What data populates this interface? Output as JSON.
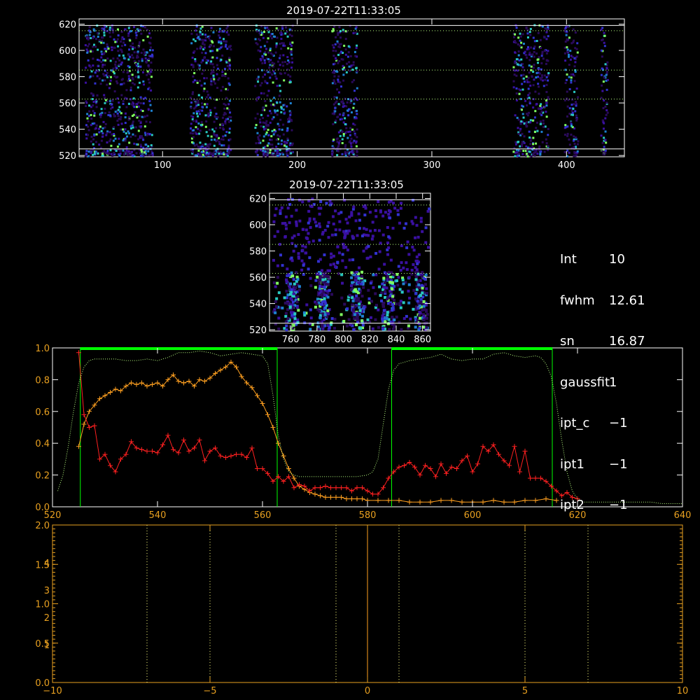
{
  "window_title": "2019-07-22T11:33:05",
  "colors": {
    "frame": "#ffffff",
    "red_axis": "#e8a020",
    "green_window": "#00ff00",
    "dotted_green": "#b8ff80",
    "red_series": "#ff2020",
    "orange_series": "#ffa020",
    "scatter_colormap": [
      "#2a0a5a",
      "#3a10a0",
      "#3232d0",
      "#1e80d0",
      "#28c8c0",
      "#80ff60"
    ]
  },
  "info_panel": [
    {
      "key": "Int",
      "value": "10"
    },
    {
      "key": "fwhm",
      "value": "12.61"
    },
    {
      "key": "sn",
      "value": "16.87"
    },
    {
      "key": "gaussfit",
      "value": "1"
    },
    {
      "key": "ipt_c",
      "value": "−1"
    },
    {
      "key": "ipt1",
      "value": "−1"
    },
    {
      "key": "ipt2",
      "value": "−1"
    }
  ],
  "chart_data": [
    {
      "type": "heatmap",
      "title": "2019-07-22T11:33:05",
      "xlim": [
        38,
        443
      ],
      "ylim": [
        519,
        624
      ],
      "xticks": [
        "100",
        "200",
        "300",
        "400"
      ],
      "xtick_values": [
        100,
        200,
        300,
        400
      ],
      "yticks": [
        "520",
        "540",
        "560",
        "580",
        "600",
        "620"
      ],
      "ytick_values": [
        520,
        540,
        560,
        580,
        600,
        620
      ],
      "hlines_solid": [
        525,
        619
      ],
      "hlines_dotted": [
        563,
        585,
        615
      ],
      "bands": [
        [
          42,
          92
        ],
        [
          120,
          150
        ],
        [
          168,
          196
        ],
        [
          225,
          244
        ],
        [
          360,
          386
        ],
        [
          398,
          408
        ],
        [
          425,
          430
        ]
      ]
    },
    {
      "type": "heatmap",
      "title": "2019-07-22T11:33:05",
      "xlim": [
        744,
        866
      ],
      "ylim": [
        519,
        624
      ],
      "xticks": [
        "760",
        "780",
        "800",
        "820",
        "840",
        "860"
      ],
      "xtick_values": [
        760,
        780,
        800,
        820,
        840,
        860
      ],
      "yticks": [
        "520",
        "540",
        "560",
        "580",
        "600",
        "620"
      ],
      "ytick_values": [
        520,
        540,
        560,
        580,
        600,
        620
      ],
      "hlines_solid": [
        525,
        619
      ],
      "hlines_dotted": [
        563,
        585,
        615
      ],
      "streaks": [
        760,
        784,
        810,
        833,
        858
      ]
    },
    {
      "type": "line",
      "xlim": [
        520,
        640
      ],
      "ylim": [
        0,
        1.0
      ],
      "xticks": [
        "520",
        "540",
        "560",
        "580",
        "600",
        "620",
        "640"
      ],
      "xtick_values": [
        520,
        540,
        560,
        580,
        600,
        620,
        640
      ],
      "yticks": [
        "0.0",
        "0.2",
        "0.4",
        "0.6",
        "0.8",
        "1.0"
      ],
      "ytick_values": [
        0,
        0.2,
        0.4,
        0.6,
        0.8,
        1.0
      ],
      "windows": [
        [
          525.3,
          562.8
        ],
        [
          584.6,
          615.2
        ]
      ],
      "series": [
        {
          "color": "#ffa020",
          "x": [
            525,
            526,
            527,
            528,
            529,
            530,
            531,
            532,
            533,
            534,
            535,
            536,
            537,
            538,
            539,
            540,
            541,
            542,
            543,
            544,
            545,
            546,
            547,
            548,
            549,
            550,
            551,
            552,
            553,
            554,
            555,
            556,
            557,
            558,
            559,
            560,
            561,
            562,
            563,
            564,
            565,
            566,
            567,
            568,
            569,
            570,
            571,
            572,
            573,
            574,
            575,
            576,
            577,
            578,
            579,
            580,
            582,
            584,
            586,
            588,
            590,
            592,
            594,
            596,
            598,
            600,
            602,
            604,
            606,
            608,
            610,
            612,
            614,
            616
          ],
          "y": [
            0.38,
            0.52,
            0.6,
            0.64,
            0.68,
            0.7,
            0.72,
            0.74,
            0.73,
            0.76,
            0.78,
            0.77,
            0.78,
            0.76,
            0.77,
            0.78,
            0.76,
            0.8,
            0.83,
            0.79,
            0.78,
            0.79,
            0.76,
            0.8,
            0.79,
            0.81,
            0.84,
            0.86,
            0.88,
            0.91,
            0.88,
            0.82,
            0.78,
            0.75,
            0.7,
            0.65,
            0.58,
            0.5,
            0.4,
            0.32,
            0.24,
            0.18,
            0.13,
            0.11,
            0.09,
            0.08,
            0.07,
            0.06,
            0.06,
            0.06,
            0.06,
            0.05,
            0.05,
            0.05,
            0.05,
            0.04,
            0.04,
            0.04,
            0.04,
            0.03,
            0.03,
            0.03,
            0.04,
            0.04,
            0.03,
            0.03,
            0.03,
            0.04,
            0.03,
            0.03,
            0.04,
            0.04,
            0.05,
            0.04
          ]
        },
        {
          "color": "#ff2020",
          "x": [
            525,
            526,
            527,
            528,
            529,
            530,
            531,
            532,
            533,
            534,
            535,
            536,
            537,
            538,
            539,
            540,
            541,
            542,
            543,
            544,
            545,
            546,
            547,
            548,
            549,
            550,
            551,
            552,
            553,
            554,
            555,
            556,
            557,
            558,
            559,
            560,
            561,
            562,
            563,
            564,
            565,
            566,
            567,
            568,
            569,
            570,
            571,
            572,
            573,
            574,
            575,
            576,
            577,
            578,
            579,
            580,
            581,
            582,
            583,
            584,
            585,
            586,
            587,
            588,
            589,
            590,
            591,
            592,
            593,
            594,
            595,
            596,
            597,
            598,
            599,
            600,
            601,
            602,
            603,
            604,
            605,
            606,
            607,
            608,
            609,
            610,
            611,
            612,
            613,
            614,
            615,
            616,
            617,
            618,
            619,
            620
          ],
          "y": [
            0.97,
            0.58,
            0.5,
            0.51,
            0.3,
            0.33,
            0.26,
            0.22,
            0.3,
            0.33,
            0.41,
            0.37,
            0.36,
            0.35,
            0.35,
            0.34,
            0.39,
            0.45,
            0.36,
            0.34,
            0.42,
            0.35,
            0.37,
            0.42,
            0.29,
            0.35,
            0.37,
            0.32,
            0.31,
            0.32,
            0.33,
            0.33,
            0.31,
            0.37,
            0.24,
            0.24,
            0.21,
            0.16,
            0.19,
            0.16,
            0.19,
            0.12,
            0.14,
            0.13,
            0.1,
            0.12,
            0.12,
            0.13,
            0.12,
            0.12,
            0.12,
            0.12,
            0.1,
            0.12,
            0.12,
            0.1,
            0.08,
            0.08,
            0.12,
            0.18,
            0.22,
            0.25,
            0.26,
            0.28,
            0.25,
            0.2,
            0.26,
            0.24,
            0.19,
            0.27,
            0.21,
            0.25,
            0.24,
            0.29,
            0.32,
            0.22,
            0.27,
            0.38,
            0.35,
            0.39,
            0.33,
            0.29,
            0.26,
            0.38,
            0.22,
            0.35,
            0.18,
            0.18,
            0.18,
            0.16,
            0.13,
            0.1,
            0.07,
            0.09,
            0.06,
            0.05
          ]
        },
        {
          "color": "#b8ff80",
          "x": [
            521,
            522,
            523,
            524,
            525,
            526,
            527,
            528,
            530,
            532,
            534,
            536,
            538,
            540,
            542,
            544,
            546,
            548,
            550,
            552,
            554,
            556,
            558,
            560,
            561,
            562,
            563,
            564,
            565,
            566,
            567,
            568,
            570,
            572,
            574,
            576,
            578,
            580,
            581,
            582,
            583,
            584,
            585,
            586,
            588,
            590,
            592,
            594,
            596,
            598,
            600,
            602,
            604,
            606,
            608,
            610,
            612,
            613,
            614,
            615,
            616,
            617,
            618,
            619,
            620,
            621,
            622,
            624,
            626,
            628,
            630,
            632,
            634,
            636,
            638,
            640
          ],
          "y": [
            0.1,
            0.2,
            0.38,
            0.6,
            0.78,
            0.88,
            0.92,
            0.93,
            0.93,
            0.93,
            0.92,
            0.92,
            0.93,
            0.92,
            0.94,
            0.97,
            0.97,
            0.98,
            0.97,
            0.95,
            0.96,
            0.97,
            0.96,
            0.95,
            0.9,
            0.7,
            0.45,
            0.3,
            0.22,
            0.2,
            0.19,
            0.19,
            0.19,
            0.19,
            0.19,
            0.19,
            0.19,
            0.2,
            0.22,
            0.3,
            0.52,
            0.74,
            0.86,
            0.9,
            0.92,
            0.93,
            0.94,
            0.96,
            0.93,
            0.92,
            0.93,
            0.93,
            0.96,
            0.97,
            0.95,
            0.94,
            0.95,
            0.94,
            0.9,
            0.82,
            0.65,
            0.42,
            0.22,
            0.1,
            0.05,
            0.03,
            0.03,
            0.03,
            0.03,
            0.03,
            0.03,
            0.03,
            0.03,
            0.02,
            0.02,
            0.02
          ]
        }
      ]
    },
    {
      "type": "line",
      "xlim": [
        -10,
        10
      ],
      "ylim": [
        0,
        2.0
      ],
      "xticks": [
        "−10",
        "−5",
        "0",
        "5",
        "10"
      ],
      "xtick_values": [
        -10,
        -5,
        0,
        5,
        10
      ],
      "yticks": [
        "0.0",
        "0.5",
        "1.0",
        "1.5",
        "2.0"
      ],
      "ytick_values": [
        0,
        0.5,
        1.0,
        1.5,
        2.0
      ],
      "secondary_yticks": [
        "1",
        "2",
        "3",
        "4"
      ],
      "dotted_vlines": [
        -7,
        -5,
        -1,
        1,
        5,
        7
      ],
      "solid_vlines": [
        0
      ],
      "series": []
    }
  ]
}
